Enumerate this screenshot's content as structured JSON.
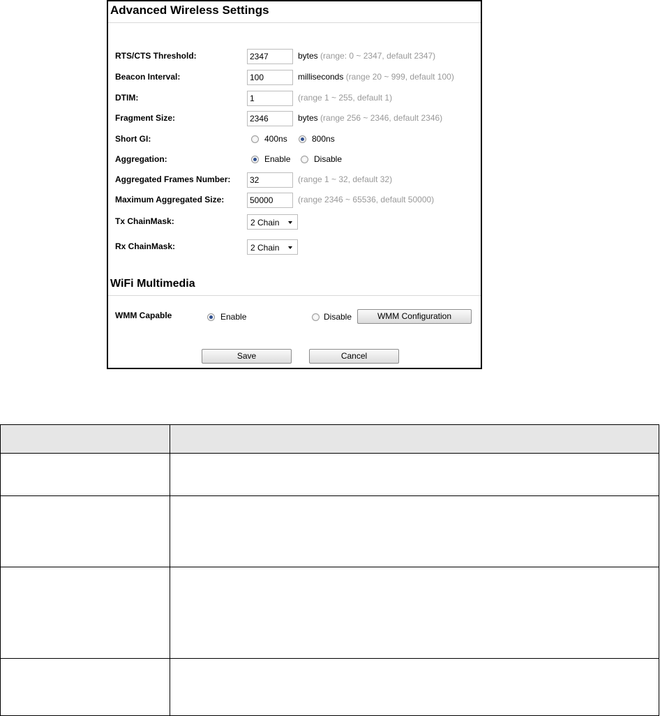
{
  "advanced": {
    "title": "Advanced Wireless Settings",
    "rts": {
      "label": "RTS/CTS Threshold:",
      "value": "2347",
      "unit": "bytes",
      "hint": " (range: 0 ~ 2347, default 2347)"
    },
    "beacon": {
      "label": "Beacon Interval:",
      "value": "100",
      "unit": "milliseconds",
      "hint": " (range 20 ~ 999, default 100)"
    },
    "dtim": {
      "label": "DTIM:",
      "value": "1",
      "hint": "(range 1 ~ 255, default 1)"
    },
    "fragment": {
      "label": "Fragment Size:",
      "value": "2346",
      "unit": "bytes",
      "hint": " (range 256 ~ 2346, default 2346)"
    },
    "short_gi": {
      "label": "Short GI:",
      "opt1": "400ns",
      "opt2": "800ns",
      "selected": "800ns"
    },
    "aggregation": {
      "label": "Aggregation:",
      "opt1": "Enable",
      "opt2": "Disable",
      "selected": "Enable"
    },
    "agg_frames": {
      "label": "Aggregated Frames Number:",
      "value": "32",
      "hint": "(range 1 ~ 32, default 32)"
    },
    "max_agg": {
      "label": "Maximum Aggregated Size:",
      "value": "50000",
      "hint": "(range 2346 ~ 65536, default 50000)"
    },
    "tx_chain": {
      "label": "Tx ChainMask:",
      "value": "2 Chain"
    },
    "rx_chain": {
      "label": "Rx ChainMask:",
      "value": "2 Chain"
    }
  },
  "wmm": {
    "title": "WiFi Multimedia",
    "label": "WMM Capable",
    "opt1": "Enable",
    "opt2": "Disable",
    "selected": "Enable",
    "config_button": "WMM Configuration"
  },
  "actions": {
    "save": "Save",
    "cancel": "Cancel"
  },
  "colors": {
    "accent_radio": "#2f4f8f",
    "table_header": "#e6e6e6",
    "hint_text": "#999999"
  }
}
